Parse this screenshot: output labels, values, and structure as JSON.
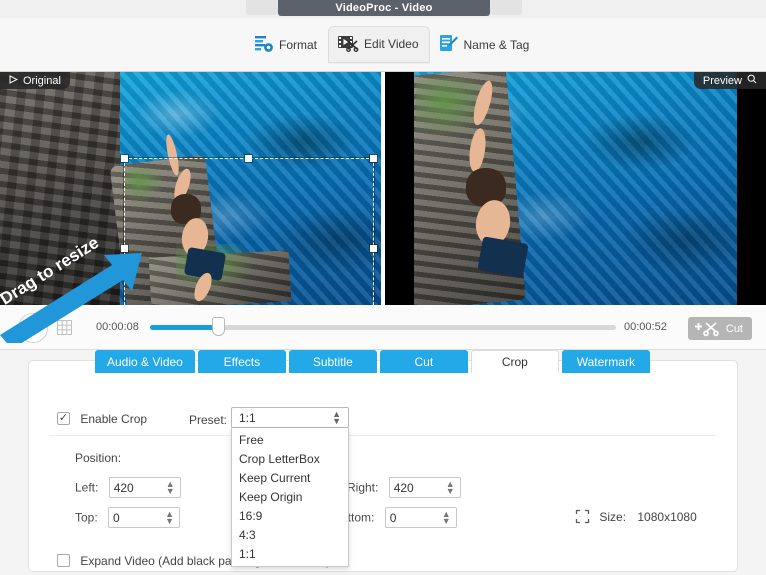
{
  "window": {
    "title": "VideoProc - Video"
  },
  "top_tabs": [
    {
      "label": "Format",
      "icon": "format-gear-icon",
      "active": false
    },
    {
      "label": "Edit Video",
      "icon": "film-scissors-icon",
      "active": true
    },
    {
      "label": "Name & Tag",
      "icon": "document-pencil-icon",
      "active": false
    }
  ],
  "preview": {
    "original_badge": "Original",
    "original_icon": "play-triangle-icon",
    "preview_badge": "Preview",
    "preview_icon": "magnifier-icon",
    "annotation": "Drag to resize"
  },
  "transport": {
    "play_icon": "play-button-icon",
    "grid_icon": "grid-icon",
    "start_time": "00:00:08",
    "end_time": "00:00:52",
    "progress_percent": 15,
    "cut_label": "Cut",
    "cut_icon": "add-scissors-icon"
  },
  "edit_tabs": [
    {
      "label": "Audio & Video",
      "active": false
    },
    {
      "label": "Effects",
      "active": false
    },
    {
      "label": "Subtitle",
      "active": false
    },
    {
      "label": "Cut",
      "active": false
    },
    {
      "label": "Crop",
      "active": true
    },
    {
      "label": "Watermark",
      "active": false
    }
  ],
  "crop": {
    "enable_label": "Enable Crop",
    "enable_checked": true,
    "preset_label": "Preset:",
    "preset_value": "1:1",
    "preset_options": [
      "Free",
      "Crop LetterBox",
      "Keep Current",
      "Keep Origin",
      "16:9",
      "4:3",
      "1:1"
    ],
    "position_label": "Position:",
    "left_label": "Left:",
    "left_value": "420",
    "right_label": "Right:",
    "right_value": "420",
    "top_label": "Top:",
    "top_value": "0",
    "bottom_label": "Bottom:",
    "bottom_value": "0",
    "size_label": "Size:",
    "size_value": "1080x1080",
    "size_icon": "resize-icon",
    "expand_label": "Expand Video (Add black padding to the video)",
    "expand_checked": false
  },
  "colors": {
    "accent": "#23a8e8",
    "progress": "#169fdb",
    "title_bar": "#5b616b"
  }
}
